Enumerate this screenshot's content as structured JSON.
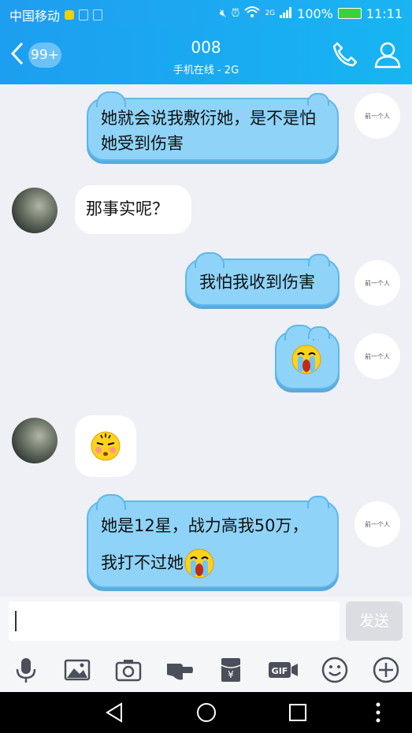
{
  "status_bar": {
    "carrier": "中国移动",
    "network": "2G",
    "battery": "100%",
    "time": "11:11"
  },
  "header": {
    "unread_count": "99+",
    "title": "008",
    "subtitle": "手机在线 - 2G"
  },
  "avatars": {
    "me_text": "前一个人"
  },
  "messages": [
    {
      "side": "out",
      "text": "她就会说我敷衍她，是不是怕她受到伤害"
    },
    {
      "side": "in",
      "text": "那事实呢？"
    },
    {
      "side": "out",
      "text": "我怕我收到伤害"
    },
    {
      "side": "out",
      "emoji": "crying-face"
    },
    {
      "side": "in",
      "emoji": "sleepy-face"
    },
    {
      "side": "out",
      "text_line1": "她是12星，战力高我50万，",
      "text_line2": "我打不过她",
      "emoji": "crying-face"
    }
  ],
  "input": {
    "value": "",
    "send_label": "发送"
  },
  "toolbar": [
    "microphone-icon",
    "image-icon",
    "camera-icon",
    "poke-icon",
    "red-packet-icon",
    "gif-icon",
    "emoji-icon",
    "plus-icon"
  ],
  "colors": {
    "header": "#1d9ef0",
    "bubble_out": "#8fd3f8",
    "bubble_out_border": "#5eb8ea",
    "background": "#eef0f5"
  }
}
